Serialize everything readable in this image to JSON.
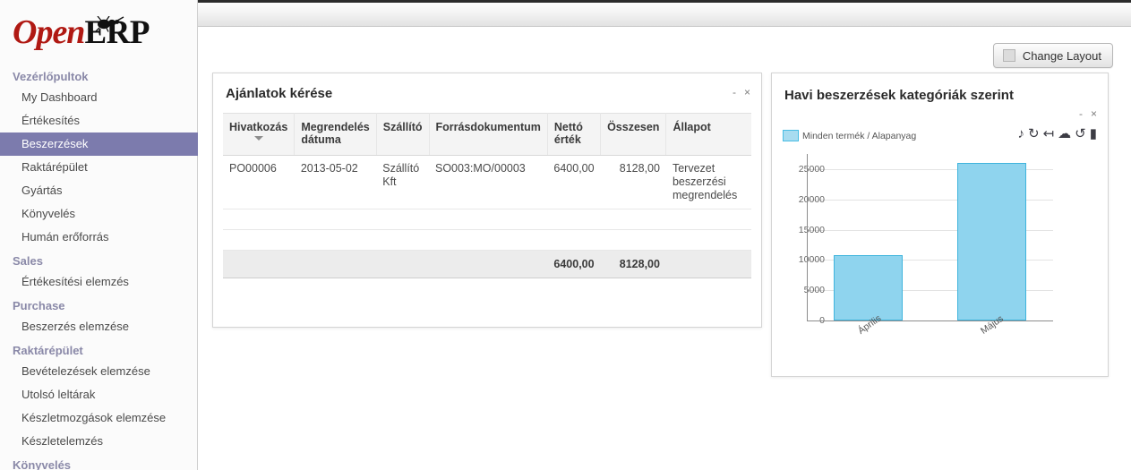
{
  "app": {
    "logo_open": "Open",
    "logo_erp": "ERP"
  },
  "topbar": {
    "change_layout_label": "Change Layout",
    "change_layout_icon": "layout-swatch-icon"
  },
  "sidebar": {
    "groups": [
      {
        "label": "Vezérlőpultok",
        "items": [
          {
            "label": "My Dashboard",
            "active": false
          },
          {
            "label": "Értékesítés",
            "active": false
          },
          {
            "label": "Beszerzések",
            "active": true
          },
          {
            "label": "Raktárépület",
            "active": false
          },
          {
            "label": "Gyártás",
            "active": false
          },
          {
            "label": "Könyvelés",
            "active": false
          },
          {
            "label": "Humán erőforrás",
            "active": false
          }
        ]
      },
      {
        "label": "Sales",
        "items": [
          {
            "label": "Értékesítési elemzés",
            "active": false
          }
        ]
      },
      {
        "label": "Purchase",
        "items": [
          {
            "label": "Beszerzés elemzése",
            "active": false
          }
        ]
      },
      {
        "label": "Raktárépület",
        "items": [
          {
            "label": "Bevételezések elemzése",
            "active": false
          },
          {
            "label": "Utolsó leltárak",
            "active": false
          },
          {
            "label": "Készletmozgások elemzése",
            "active": false
          },
          {
            "label": "Készletelemzés",
            "active": false
          }
        ]
      },
      {
        "label": "Könyvelés",
        "items": []
      }
    ]
  },
  "list_panel": {
    "title": "Ajánlatok kérése",
    "minimize_label": "-",
    "close_label": "×",
    "columns": [
      {
        "label": "Hivatkozás",
        "sorted": "desc"
      },
      {
        "label": "Megrendelés dátuma"
      },
      {
        "label": "Szállító"
      },
      {
        "label": "Forrásdokumentum"
      },
      {
        "label": "Nettó érték"
      },
      {
        "label": "Összesen"
      },
      {
        "label": "Állapot"
      }
    ],
    "rows": [
      {
        "reference": "PO00006",
        "order_date": "2013-05-02",
        "supplier": "Szállító Kft",
        "source_document": "SO003:MO/00003",
        "net_value": "6400,00",
        "total": "8128,00",
        "state": "Tervezet beszerzési megrendelés"
      }
    ],
    "footer": {
      "net_value": "6400,00",
      "total": "8128,00"
    }
  },
  "chart_panel": {
    "title": "Havi beszerzések kategóriák szerint",
    "minimize_label": "-",
    "close_label": "×",
    "legend_label": "Minden termék / Alapanyag",
    "toolbar_icons": [
      "music-note-icon",
      "rotate-left-icon",
      "undo-arrow-icon",
      "cloud-icon",
      "rotate-right-icon",
      "folder-icon"
    ]
  },
  "chart_data": {
    "type": "bar",
    "title": "Havi beszerzések kategóriák szerint",
    "xlabel": "",
    "ylabel": "",
    "categories": [
      "Április",
      "Május"
    ],
    "series": [
      {
        "name": "Minden termék / Alapanyag",
        "values": [
          10800,
          26000
        ],
        "color": "#8fd4ee"
      }
    ],
    "ylim": [
      0,
      27500
    ],
    "yticks": [
      0,
      5000,
      10000,
      15000,
      20000,
      25000
    ],
    "ytick_labels": [
      "0",
      "5000",
      "10000",
      "15000",
      "20000",
      "25000"
    ],
    "grid": true,
    "legend_position": "top-left",
    "bar_border_color": "#3fb4dd"
  },
  "colors": {
    "accent": "#7c7bad",
    "brand_red": "#b01913",
    "bar_fill": "#8fd4ee",
    "bar_stroke": "#3fb4dd",
    "group_heading": "#8a89a8"
  }
}
